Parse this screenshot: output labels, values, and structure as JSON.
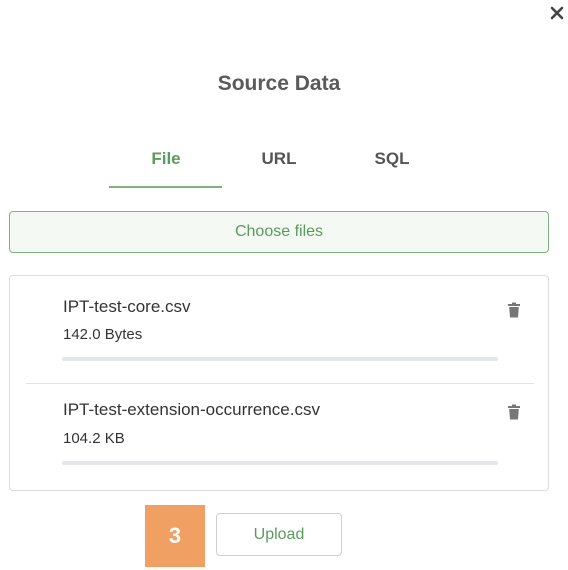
{
  "dialog": {
    "title": "Source Data",
    "close_icon": "close-icon"
  },
  "tabs": [
    {
      "label": "File",
      "active": true
    },
    {
      "label": "URL",
      "active": false
    },
    {
      "label": "SQL",
      "active": false
    }
  ],
  "choose_files": {
    "label": "Choose files"
  },
  "files": [
    {
      "name": "IPT-test-core.csv",
      "size": "142.0 Bytes",
      "progress_percent": 0,
      "delete_icon": "trash-icon"
    },
    {
      "name": "IPT-test-extension-occurrence.csv",
      "size": "104.2 KB",
      "progress_percent": 0,
      "delete_icon": "trash-icon"
    }
  ],
  "step_badge": {
    "number": "3"
  },
  "upload": {
    "label": "Upload"
  },
  "colors": {
    "accent": "#5b9b5b",
    "accent_border": "#7fb27f",
    "badge": "#f0a062",
    "progress_track": "#e3e6ea"
  }
}
